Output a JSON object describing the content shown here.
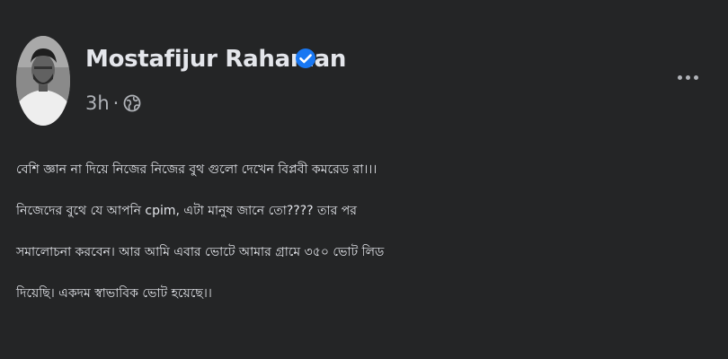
{
  "post": {
    "author": "Mostafijur Rahaman",
    "verified": true,
    "time": "3h",
    "separator": "·",
    "privacy_icon": "globe-icon",
    "more_icon": "ellipsis-icon",
    "text_lines": [
      "বেশি জ্ঞান না দিয়ে নিজের নিজের বুথ গুলো দেখেন বিপ্লবী কমরেড রা।।।",
      "নিজেদের বুথে যে আপনি cpim, এটা মানুষ জানে তো???? তার পর",
      "সমালোচনা করবেন। আর আমি এবার ভোটে আমার গ্রামে ৩৫০ ভোট লিড",
      "দিয়েছি। একদম স্বাভাবিক ভোট হয়েছে।।"
    ]
  },
  "colors": {
    "background": "#242526",
    "primary_text": "#e4e6eb",
    "secondary_text": "#b0b3b8",
    "verified_badge": "#1877f2"
  }
}
